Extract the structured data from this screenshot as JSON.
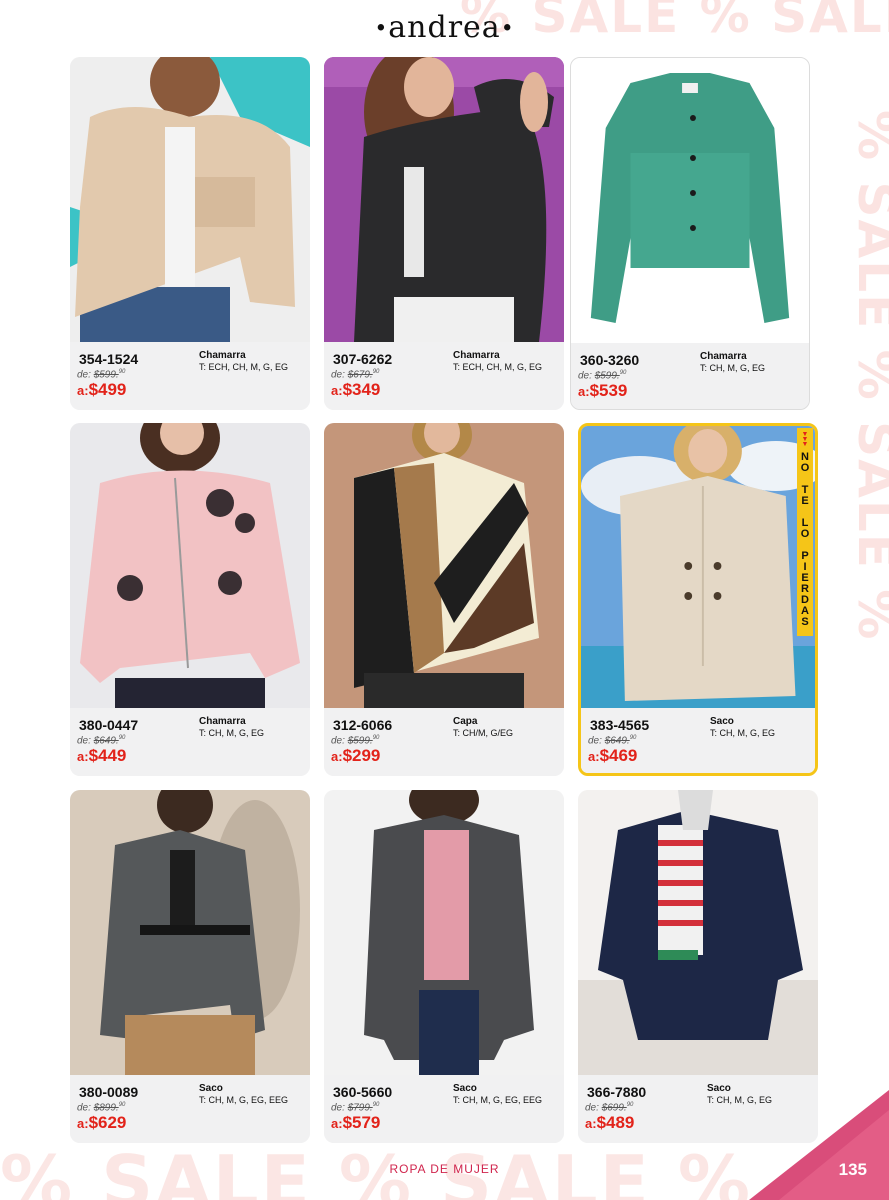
{
  "brand": "andrea",
  "watermark": "% SALE % SALE %",
  "section_label": "ROPA DE MUJER",
  "page_number": "135",
  "colors": {
    "price_red": "#e2231a",
    "accent_yellow": "#f5c518",
    "pink": "#d0254d"
  },
  "products": [
    {
      "code": "354-1524",
      "type": "Chamarra",
      "sizes": "T: ECH, CH, M, G, EG",
      "old_label": "de:",
      "old_price": "$599.",
      "old_cents": "90",
      "price_label": "a:",
      "price": "$499"
    },
    {
      "code": "307-6262",
      "type": "Chamarra",
      "sizes": "T: ECH, CH, M, G, EG",
      "old_label": "de:",
      "old_price": "$679.",
      "old_cents": "90",
      "price_label": "a:",
      "price": "$349"
    },
    {
      "code": "360-3260",
      "type": "Chamarra",
      "sizes": "T: CH, M, G, EG",
      "old_label": "de:",
      "old_price": "$599.",
      "old_cents": "90",
      "price_label": "a:",
      "price": "$539"
    },
    {
      "code": "380-0447",
      "type": "Chamarra",
      "sizes": "T: CH, M, G, EG",
      "old_label": "de:",
      "old_price": "$649.",
      "old_cents": "90",
      "price_label": "a:",
      "price": "$449"
    },
    {
      "code": "312-6066",
      "type": "Capa",
      "sizes": "T: CH/M, G/EG",
      "old_label": "de:",
      "old_price": "$599.",
      "old_cents": "90",
      "price_label": "a:",
      "price": "$299"
    },
    {
      "code": "383-4565",
      "type": "Saco",
      "sizes": "T: CH, M, G, EG",
      "old_label": "de:",
      "old_price": "$649.",
      "old_cents": "90",
      "price_label": "a:",
      "price": "$469",
      "badge": "NO TE LO PIERDAS"
    },
    {
      "code": "380-0089",
      "type": "Saco",
      "sizes": "T: CH, M, G, EG, EEG",
      "old_label": "de:",
      "old_price": "$899.",
      "old_cents": "90",
      "price_label": "a:",
      "price": "$629"
    },
    {
      "code": "360-5660",
      "type": "Saco",
      "sizes": "T: CH, M, G, EG, EEG",
      "old_label": "de:",
      "old_price": "$799.",
      "old_cents": "90",
      "price_label": "a:",
      "price": "$579"
    },
    {
      "code": "366-7880",
      "type": "Saco",
      "sizes": "T: CH, M, G, EG",
      "old_label": "de:",
      "old_price": "$699.",
      "old_cents": "90",
      "price_label": "a:",
      "price": "$489"
    }
  ]
}
